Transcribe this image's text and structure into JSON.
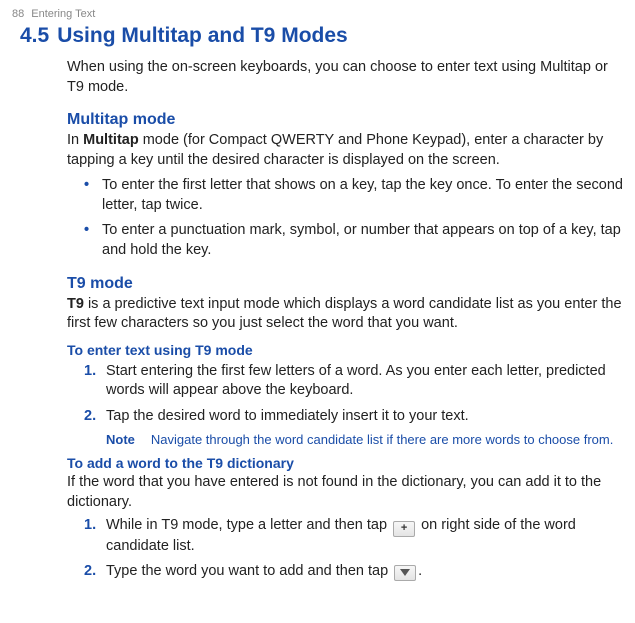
{
  "header": {
    "page_number": "88",
    "chapter": "Entering Text"
  },
  "section": {
    "number": "4.5",
    "title": "Using Multitap and T9 Modes",
    "intro": "When using the on-screen keyboards, you can choose to enter text using Multitap or T9 mode."
  },
  "multitap": {
    "heading": "Multitap mode",
    "lead_prefix": "In ",
    "lead_bold": "Multitap",
    "lead_suffix": " mode (for Compact QWERTY and Phone Keypad), enter a character by tapping a key until the desired character is displayed on the screen.",
    "bullets": [
      "To enter the first letter that shows on a key, tap the key once. To enter the second letter, tap twice.",
      "To enter a punctuation mark, symbol, or number that appears on top of a key, tap and hold the key."
    ]
  },
  "t9": {
    "heading": "T9 mode",
    "lead_bold": "T9",
    "lead_suffix": " is a predictive text input mode which displays a word candidate list as you enter the first few characters so you just select the word that you want.",
    "proc1_head": "To enter text using T9 mode",
    "proc1_steps": [
      "Start entering the first few letters of a word. As you enter each letter, predicted words will appear above the keyboard.",
      "Tap the desired word to immediately insert it to your text."
    ],
    "note_label": "Note",
    "note_text": "Navigate through the word candidate list if there are more words to choose from.",
    "proc2_head": "To add a word to the T9 dictionary",
    "proc2_intro": "If the word that you have entered is not found in the dictionary, you can add it to the dictionary.",
    "proc2_steps": {
      "s1_a": "While in T9 mode, type a letter and then tap ",
      "s1_b": " on right side of the word candidate list.",
      "s2_a": "Type the word you want to add and then tap ",
      "s2_b": "."
    },
    "icons": {
      "plus_key": "+",
      "confirm_key": "chevron-down"
    }
  }
}
